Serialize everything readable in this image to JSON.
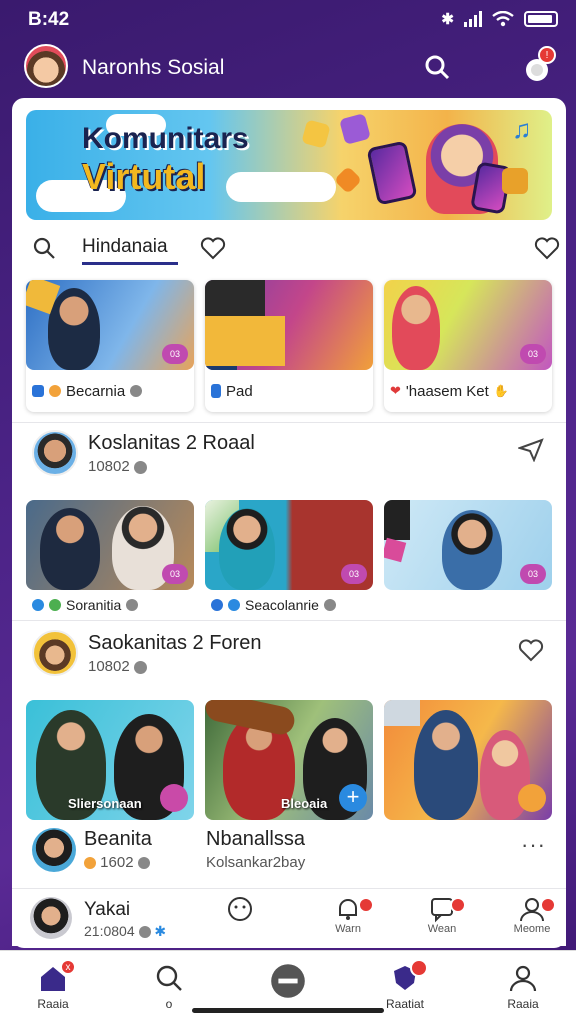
{
  "status_bar": {
    "time": "B:42"
  },
  "app_bar": {
    "title": "Naronhs Sosial"
  },
  "banner": {
    "line1": "Komunitars",
    "line2": "Virtutal"
  },
  "tabs": {
    "active_label": "Hindanaia"
  },
  "featured_tiles": [
    {
      "caption": "Becarnia",
      "badge": "03"
    },
    {
      "caption": "Pad"
    },
    {
      "caption": "'haasem Ket",
      "badge": "03"
    }
  ],
  "post1": {
    "name": "Koslanitas 2 Roaal",
    "meta": "10802",
    "tiles": [
      {
        "caption": "Soranitia",
        "badge": "03"
      },
      {
        "caption": "Seacolanrie",
        "badge": "03"
      },
      {
        "caption": "",
        "badge": "03"
      }
    ]
  },
  "post2": {
    "name": "Saokanitas 2 Foren",
    "meta": "10802",
    "tiles": [
      {
        "overlay": "Sliersonaan"
      },
      {
        "overlay": "Bleoaia"
      },
      {
        "overlay": ""
      }
    ]
  },
  "names_row": {
    "left_name": "Beanita",
    "left_meta": "1602",
    "mid_name": "Nbanallssa",
    "mid_meta": "Kolsankar2bay"
  },
  "mini_bar": {
    "user_name": "Yakai",
    "user_meta": "21:0804",
    "items": [
      "",
      "Warn",
      "Wean",
      "Meome"
    ]
  },
  "bottom_nav": {
    "home": "Raaia",
    "search": "o",
    "center": "",
    "alerts": "Raatiat",
    "profile": "Raaia"
  }
}
